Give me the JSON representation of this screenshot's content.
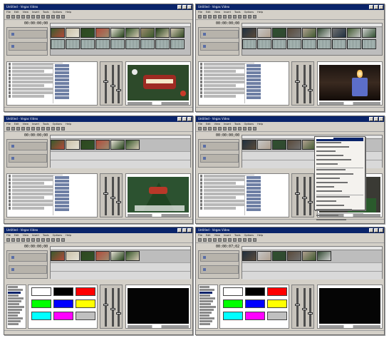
{
  "app": {
    "window_title": "Untitled - Vegas Video",
    "menu_items": [
      "File",
      "Edit",
      "View",
      "Insert",
      "Tools",
      "Options",
      "Help"
    ],
    "timecodes": [
      "00:00:00;00",
      "00:00:00;00",
      "00:00:00;00",
      "00:00:00;00",
      "00:00:00;00",
      "00:00:07;02"
    ]
  },
  "colors": {
    "title_bar": "#0a246a",
    "window_face": "#d4d0c8"
  },
  "panels": [
    {
      "id": 1,
      "layout": "explorer",
      "preview_scene": "christmas-ornament"
    },
    {
      "id": 2,
      "layout": "explorer",
      "preview_scene": "candle"
    },
    {
      "id": 3,
      "layout": "explorer",
      "preview_scene": "christmas-tree"
    },
    {
      "id": 4,
      "layout": "explorer-context-menu",
      "preview_scene": "christmas-tree-small"
    },
    {
      "id": 5,
      "layout": "generated-media",
      "preview_scene": "black"
    },
    {
      "id": 6,
      "layout": "generated-media",
      "preview_scene": "black"
    }
  ],
  "swatch_colors": [
    "#ffffff",
    "#000000",
    "#ff0000",
    "#00ff00",
    "#0000ff",
    "#ffff00",
    "#00ffff",
    "#ff00ff",
    "#c0c0c0"
  ]
}
